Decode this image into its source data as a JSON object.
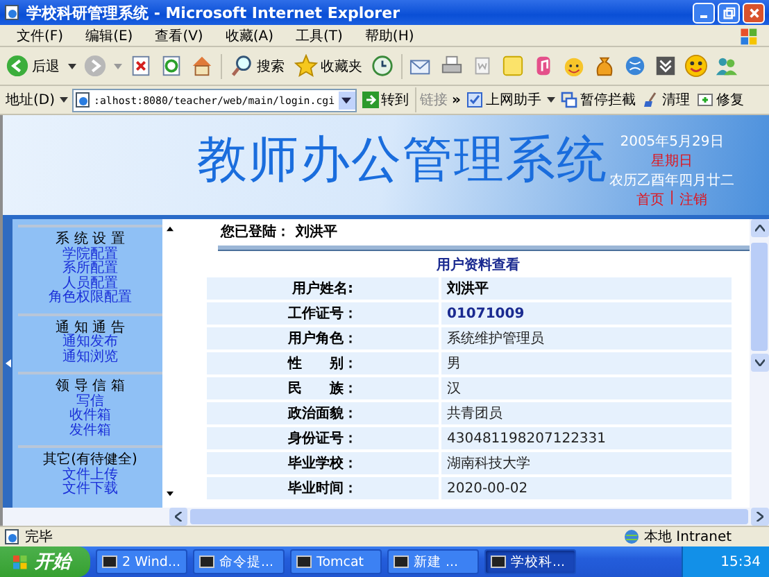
{
  "window": {
    "title": "学校科研管理系统 - Microsoft Internet Explorer"
  },
  "menu": [
    "文件(F)",
    "编辑(E)",
    "查看(V)",
    "收藏(A)",
    "工具(T)",
    "帮助(H)"
  ],
  "toolbar": {
    "back": "后退",
    "search": "搜索",
    "favorites": "收藏夹"
  },
  "address": {
    "label": "地址(D)",
    "value": ":alhost:8080/teacher/web/main/login.cgi",
    "go": "转到",
    "links": "链接",
    "links_more": "»",
    "helper": "上网助手",
    "block": "暂停拦截",
    "clean": "清理",
    "repair": "修复"
  },
  "banner": {
    "title": "教师办公管理系统",
    "date": "2005年5月29日",
    "weekday": "星期日",
    "lunar": "农历乙酉年四月廿二",
    "links": [
      "首页",
      "注销"
    ],
    "separator": "|"
  },
  "sidebar": {
    "groups": [
      {
        "title": "系 统 设 置",
        "items": [
          "学院配置",
          "系所配置",
          "人员配置",
          "角色权限配置"
        ]
      },
      {
        "title": "通 知 通 告",
        "items": [
          "通知发布",
          "通知浏览"
        ]
      },
      {
        "title": "领 导 信 箱",
        "items": [
          "写信",
          "收件箱",
          "发件箱"
        ]
      },
      {
        "title": "其它(有待健全)",
        "items": [
          "文件上传",
          "文件下载"
        ]
      }
    ]
  },
  "login": {
    "label": "您已登陆：",
    "user": "刘洪平"
  },
  "profile": {
    "title": "用户资料查看",
    "rows": [
      {
        "label": "用户姓名:",
        "value": "刘洪平",
        "kind": "name"
      },
      {
        "label": "工作证号：",
        "value": "01071009",
        "kind": "id"
      },
      {
        "label": "用户角色：",
        "value": "系统维护管理员",
        "kind": "plain"
      },
      {
        "label": "性　　别：",
        "value": "男",
        "kind": "plain"
      },
      {
        "label": "民　　族：",
        "value": "汉",
        "kind": "plain"
      },
      {
        "label": "政治面貌：",
        "value": "共青团员",
        "kind": "plain"
      },
      {
        "label": "身份证号：",
        "value": "430481198207122331",
        "kind": "plain"
      },
      {
        "label": "毕业学校：",
        "value": "湖南科技大学",
        "kind": "plain"
      },
      {
        "label": "毕业时间：",
        "value": "2020-00-02",
        "kind": "plain"
      }
    ]
  },
  "status_bar": {
    "text": "完毕",
    "zone": "本地 Intranet"
  },
  "taskbar": {
    "start": "开始",
    "tasks": [
      {
        "label": "2 Wind...",
        "selected": false
      },
      {
        "label": "命令提...",
        "selected": false
      },
      {
        "label": "Tomcat",
        "selected": false
      },
      {
        "label": "新建 ...",
        "selected": false
      },
      {
        "label": "学校科...",
        "selected": true
      }
    ],
    "clock": "15:34"
  }
}
